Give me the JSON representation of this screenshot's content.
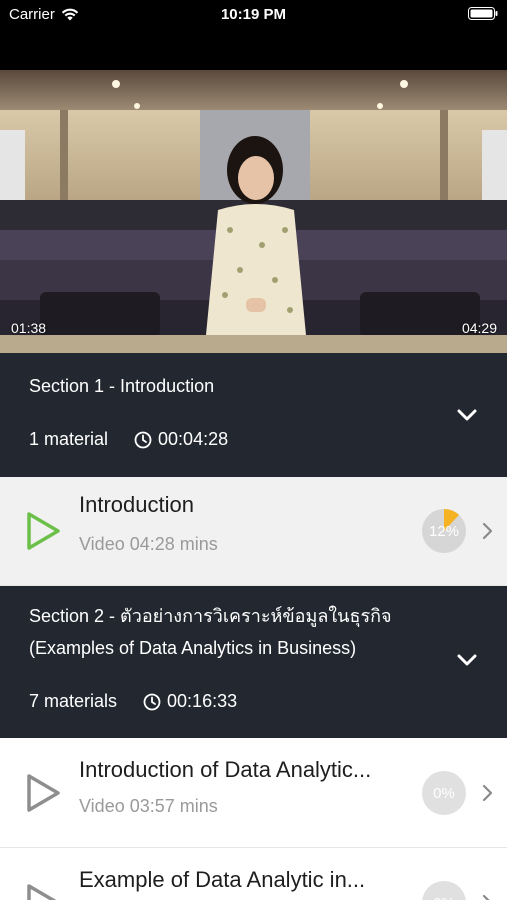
{
  "status_bar": {
    "carrier": "Carrier",
    "time": "10:19 PM"
  },
  "video": {
    "elapsed": "01:38",
    "duration": "04:29"
  },
  "sections": [
    {
      "title": "Section 1 - Introduction",
      "material_count": "1 material",
      "duration": "00:04:28"
    },
    {
      "title_line1": "Section 2 - ตัวอย่างการวิเคราะห์ข้อมูลในธุรกิจ",
      "title_line2": "(Examples of Data Analytics in Business)",
      "material_count": "7 materials",
      "duration": "00:16:33"
    }
  ],
  "lessons": [
    {
      "title": "Introduction",
      "subtitle": "Video 04:28 mins",
      "progress_label": "12%",
      "progress": 0.12,
      "active": true
    },
    {
      "title": "Introduction of Data Analytic...",
      "subtitle": "Video 03:57 mins",
      "progress_label": "0%",
      "progress": 0
    },
    {
      "title": "Example of Data Analytic in...",
      "subtitle": "",
      "progress_label": "0%",
      "progress": 0
    }
  ],
  "colors": {
    "accent_green": "#6cc04a",
    "progress_orange": "#f5b324",
    "section_bg": "#232830",
    "active_row_bg": "#f1f1f1"
  }
}
